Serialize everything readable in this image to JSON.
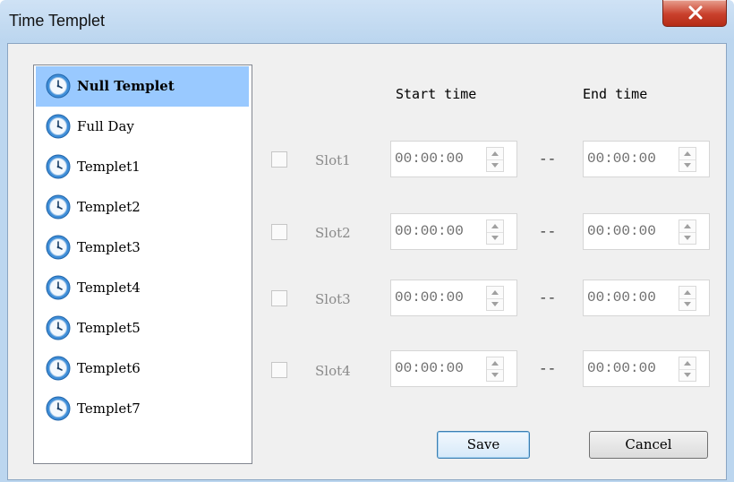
{
  "window": {
    "title": "Time Templet"
  },
  "templates": {
    "items": [
      {
        "label": "Null Templet",
        "selected": true,
        "icon": "clock-icon"
      },
      {
        "label": "Full Day",
        "selected": false,
        "icon": "clock-icon"
      },
      {
        "label": "Templet1",
        "selected": false,
        "icon": "clock-icon"
      },
      {
        "label": "Templet2",
        "selected": false,
        "icon": "clock-icon"
      },
      {
        "label": "Templet3",
        "selected": false,
        "icon": "clock-icon"
      },
      {
        "label": "Templet4",
        "selected": false,
        "icon": "clock-icon"
      },
      {
        "label": "Templet5",
        "selected": false,
        "icon": "clock-icon"
      },
      {
        "label": "Templet6",
        "selected": false,
        "icon": "clock-icon"
      },
      {
        "label": "Templet7",
        "selected": false,
        "icon": "clock-icon"
      }
    ]
  },
  "headers": {
    "start": "Start time",
    "end": "End time"
  },
  "slots": [
    {
      "label": "Slot1",
      "checked": false,
      "start": "00:00:00",
      "separator": "--",
      "end": "00:00:00"
    },
    {
      "label": "Slot2",
      "checked": false,
      "start": "00:00:00",
      "separator": "--",
      "end": "00:00:00"
    },
    {
      "label": "Slot3",
      "checked": false,
      "start": "00:00:00",
      "separator": "--",
      "end": "00:00:00"
    },
    {
      "label": "Slot4",
      "checked": false,
      "start": "00:00:00",
      "separator": "--",
      "end": "00:00:00"
    }
  ],
  "buttons": {
    "save": "Save",
    "cancel": "Cancel"
  },
  "colors": {
    "selection": "#99c9ff",
    "close_button": "#c9402c"
  }
}
